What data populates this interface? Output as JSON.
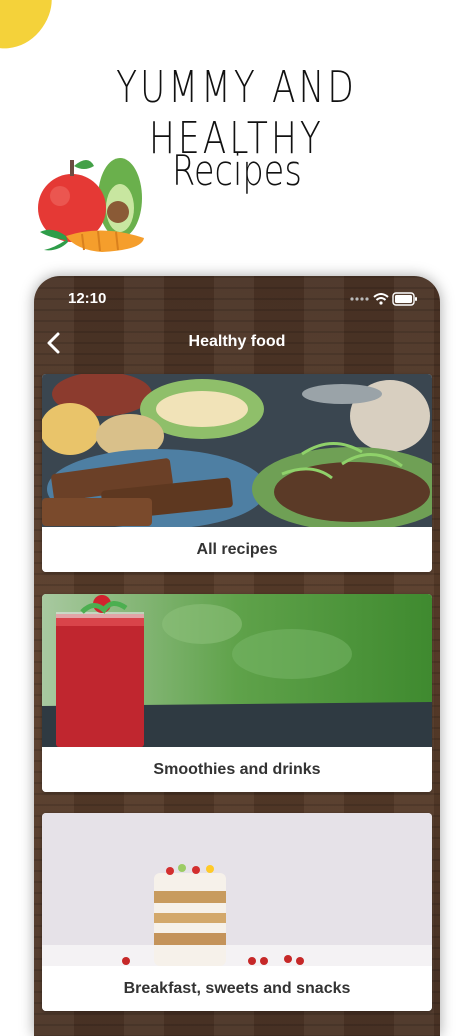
{
  "promo": {
    "headline": "YUMMY AND HEALTHY",
    "subline": "Recipes"
  },
  "status_bar": {
    "time": "12:10"
  },
  "nav": {
    "title": "Healthy food",
    "back_icon": "chevron-left-icon"
  },
  "categories": [
    {
      "label": "All recipes"
    },
    {
      "label": "Smoothies and drinks"
    },
    {
      "label": "Breakfast, sweets and snacks"
    }
  ],
  "colors": {
    "wood_dark": "#4a3325",
    "card_bg": "#ffffff",
    "label_text": "#333333",
    "accent_yellow": "#f4d23a"
  }
}
